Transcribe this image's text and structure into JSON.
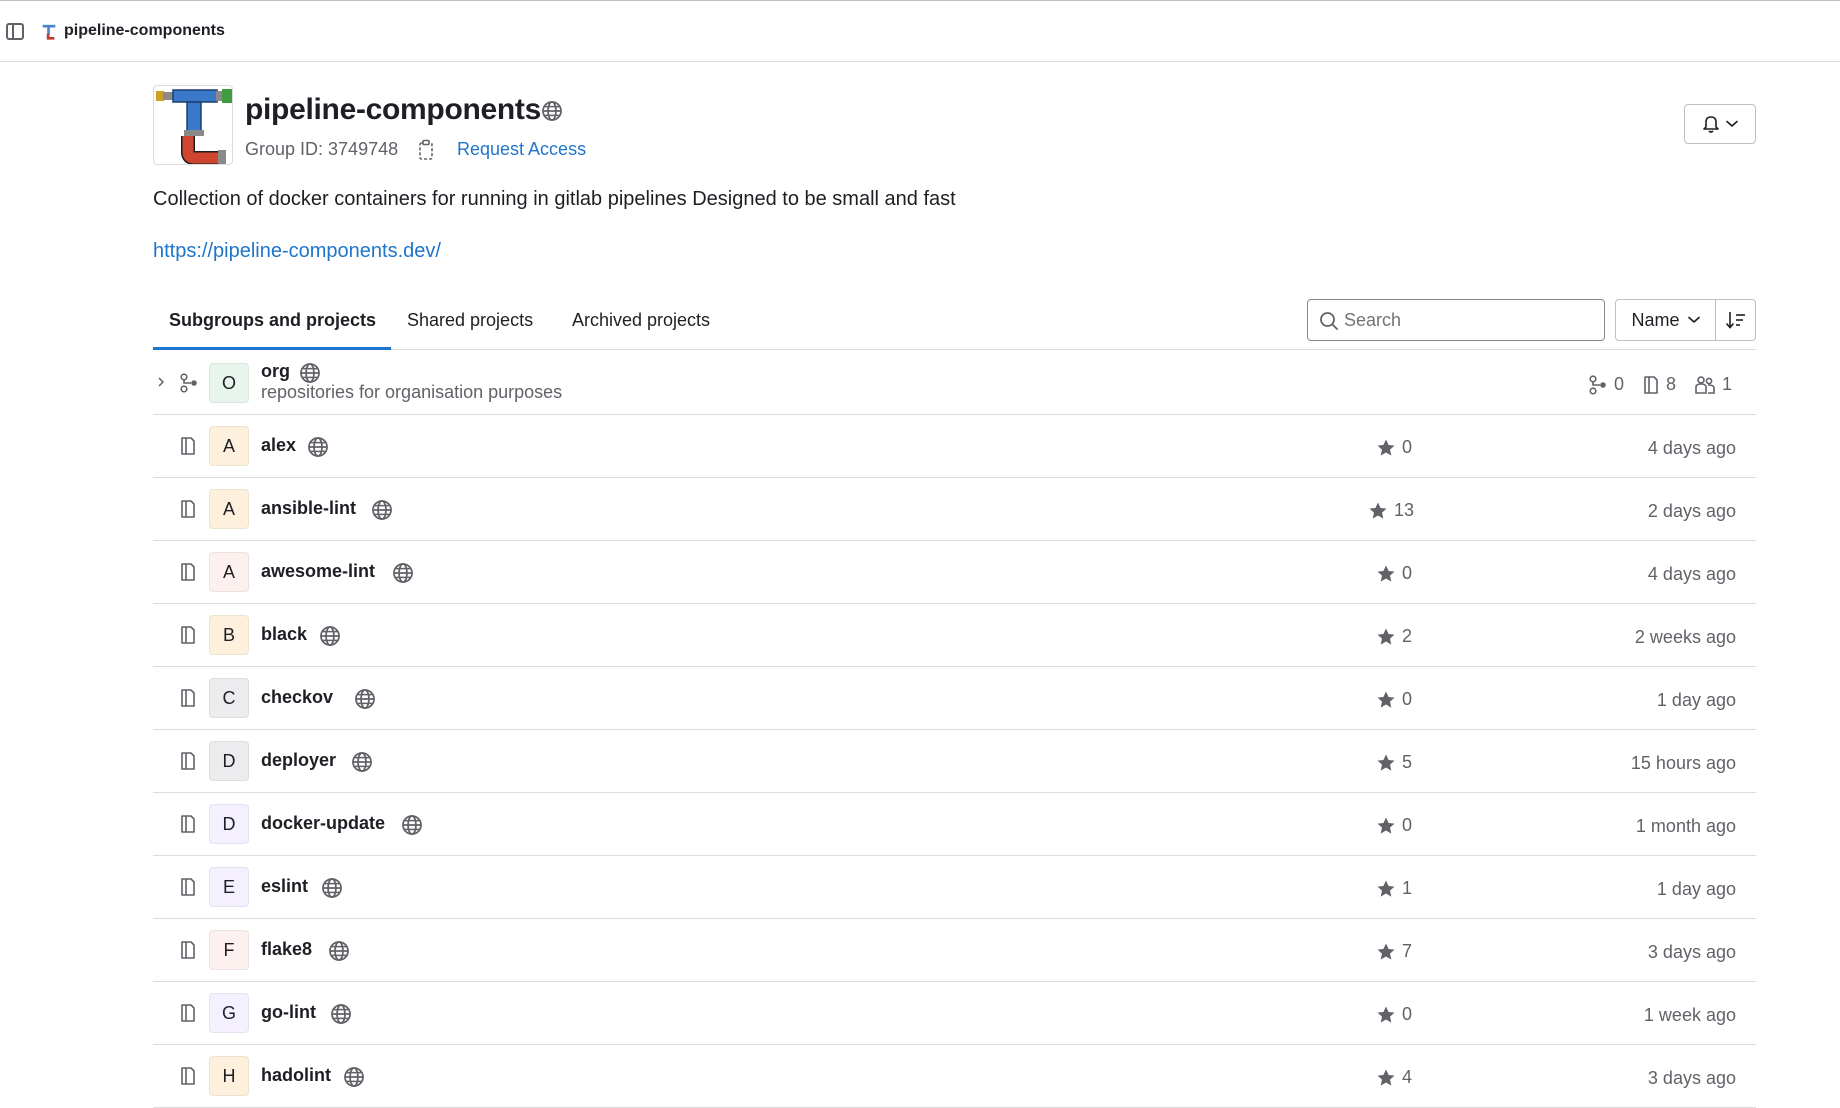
{
  "breadcrumb": {
    "label": "pipeline-components"
  },
  "group": {
    "name": "pipeline-components",
    "id_label": "Group ID: 3749748",
    "request_access": "Request Access",
    "description": "Collection of docker containers for running in gitlab pipelines Designed to be small and fast",
    "website": "https://pipeline-components.dev/"
  },
  "tabs": [
    {
      "label": "Subgroups and projects",
      "active": true
    },
    {
      "label": "Shared projects",
      "active": false
    },
    {
      "label": "Archived projects",
      "active": false
    }
  ],
  "search": {
    "placeholder": "Search"
  },
  "sort": {
    "label": "Name"
  },
  "subgroup": {
    "avatar": "O",
    "name": "org",
    "description": "repositories for organisation purposes",
    "subgroups": "0",
    "projects": "8",
    "members": "1"
  },
  "projects": [
    {
      "avatar": "A",
      "name": "alex",
      "stars": "0",
      "updated": "4 days ago",
      "avatar_color": "#fdf1dd"
    },
    {
      "avatar": "A",
      "name": "ansible-lint",
      "stars": "13",
      "updated": "2 days ago",
      "avatar_color": "#fdf1dd"
    },
    {
      "avatar": "A",
      "name": "awesome-lint",
      "stars": "0",
      "updated": "4 days ago",
      "avatar_color": "#fcf1ef"
    },
    {
      "avatar": "B",
      "name": "black",
      "stars": "2",
      "updated": "2 weeks ago",
      "avatar_color": "#fdf1dd"
    },
    {
      "avatar": "C",
      "name": "checkov",
      "stars": "0",
      "updated": "1 day ago",
      "avatar_color": "#ececef"
    },
    {
      "avatar": "D",
      "name": "deployer",
      "stars": "5",
      "updated": "15 hours ago",
      "avatar_color": "#ececef"
    },
    {
      "avatar": "D",
      "name": "docker-update",
      "stars": "0",
      "updated": "1 month ago",
      "avatar_color": "#f4f0ff"
    },
    {
      "avatar": "E",
      "name": "eslint",
      "stars": "1",
      "updated": "1 day ago",
      "avatar_color": "#f4f0ff"
    },
    {
      "avatar": "F",
      "name": "flake8",
      "stars": "7",
      "updated": "3 days ago",
      "avatar_color": "#fcf1ef"
    },
    {
      "avatar": "G",
      "name": "go-lint",
      "stars": "0",
      "updated": "1 week ago",
      "avatar_color": "#f4f0ff"
    },
    {
      "avatar": "H",
      "name": "hadolint",
      "stars": "4",
      "updated": "3 days ago",
      "avatar_color": "#fdf1dd"
    }
  ],
  "colors": {
    "link": "#1f75cb",
    "text": "#1f1e24",
    "muted": "#626168",
    "border": "#dcdcde"
  },
  "icons": [
    "sidebar-toggle-icon",
    "globe-icon",
    "copy-icon",
    "bell-icon",
    "chevron-down-icon",
    "search-icon",
    "sort-direction-icon",
    "chevron-right-icon",
    "subgroup-icon",
    "project-icon",
    "star-icon",
    "members-icon"
  ]
}
